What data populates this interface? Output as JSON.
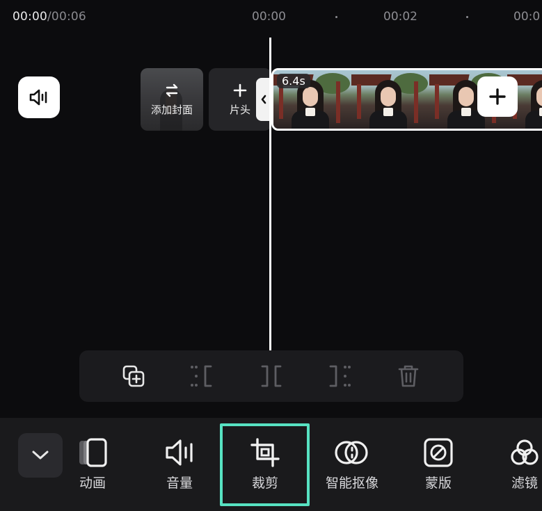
{
  "header": {
    "current_time": "00:00",
    "total_time": "/00:06",
    "ticks": [
      "00:00",
      "00:02",
      "00:0"
    ]
  },
  "timeline": {
    "cover_label": "添加封面",
    "head_label": "片头",
    "clip_duration": "6.4s"
  },
  "bottom_toolbar": {
    "items": [
      {
        "label": "动画",
        "icon": "animation-icon"
      },
      {
        "label": "音量",
        "icon": "volume-icon"
      },
      {
        "label": "裁剪",
        "icon": "crop-icon"
      },
      {
        "label": "智能抠像",
        "icon": "smart-cutout-icon"
      },
      {
        "label": "蒙版",
        "icon": "mask-icon"
      },
      {
        "label": "滤镜",
        "icon": "filter-icon"
      }
    ],
    "selected": "裁剪"
  },
  "colors": {
    "background": "#0c0c0e",
    "panel": "#1a1a1c",
    "accent": "#57e2c2"
  }
}
